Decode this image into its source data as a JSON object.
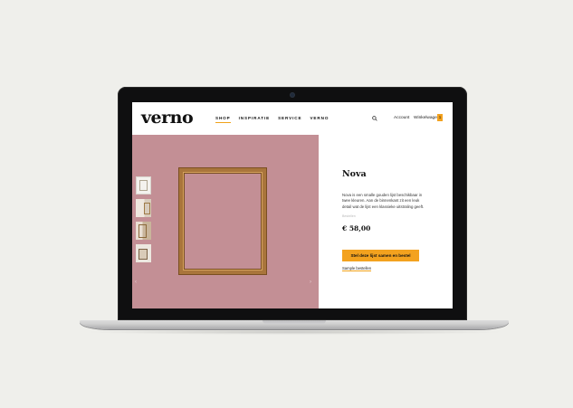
{
  "site": {
    "logo": "verno",
    "nav": [
      "SHOP",
      "INSPIRATIE",
      "SERVICE",
      "VERNO"
    ],
    "active_nav": "SHOP",
    "account": "Account",
    "cart": "Winkelwagen",
    "cart_count": "1"
  },
  "product": {
    "title": "Nova",
    "description": "Nova is een smalle gouden lijst beschikbaar in twee kleuren. Aan de binnenkant zit een leuk detail wat de lijst een klassieke uitstraling geeft.",
    "meta": "Bestellen",
    "price": "€ 58,00",
    "cta": "Stel deze lijst samen en bestel",
    "sample_link": "Sample bestellen"
  },
  "gallery": {
    "thumbnails": [
      "thumbnail-frame-white",
      "thumbnail-wall-1",
      "thumbnail-wall-2",
      "thumbnail-room"
    ],
    "prev_arrow": "‹",
    "next_arrow": "›"
  },
  "colors": {
    "background": "#efefeb",
    "hero_pink": "#c38f95",
    "accent": "#f3a21f",
    "frame_gold": "#a9753b"
  },
  "icons": {
    "search": "search-icon"
  }
}
